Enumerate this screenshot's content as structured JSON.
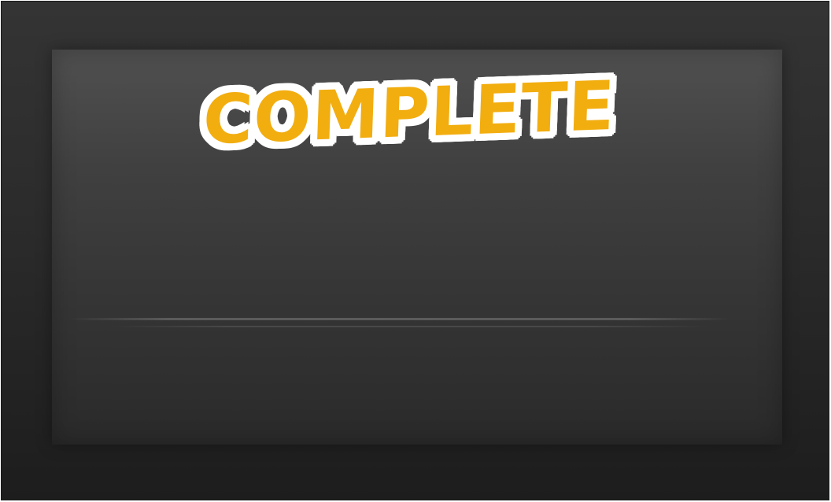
{
  "game_screen": {
    "title": "COMPLETE",
    "colors": {
      "title_fill": "#f2ad0f",
      "title_outline": "#ffffff",
      "frame": "#2b2b2b",
      "panel": "#404040"
    }
  }
}
